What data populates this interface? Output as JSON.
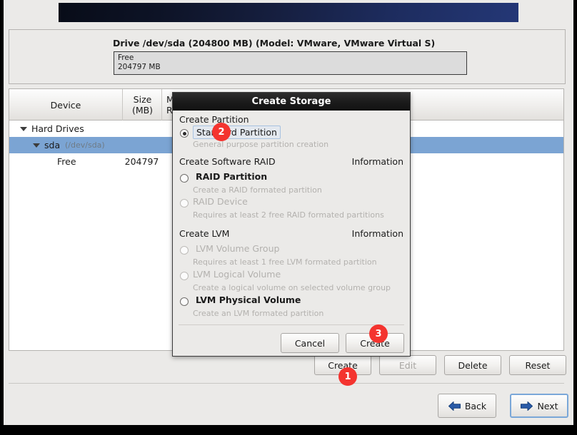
{
  "window": {
    "background_color": "#ebeae8",
    "banner_color_start": "#080c18",
    "banner_color_end": "#243776"
  },
  "drive_panel": {
    "title": "Drive /dev/sda (204800 MB) (Model: VMware, VMware Virtual S)",
    "segment_label": "Free",
    "segment_size": "204797 MB"
  },
  "table": {
    "headers": [
      {
        "label": "Device"
      },
      {
        "label": "Size\n(MB)",
        "line1": "Size",
        "line2": "(MB)"
      },
      {
        "label": "Mount Point/\nRAID/Volume",
        "line1": "Mo",
        "line2": "RA"
      },
      {
        "line1": "",
        "line2": ""
      }
    ],
    "rows": [
      {
        "name": "Hard Drives",
        "sub": "",
        "size": "",
        "indent": 0,
        "expander": true,
        "selected": false
      },
      {
        "name": "sda",
        "sub": "(/dev/sda)",
        "size": "",
        "indent": 1,
        "expander": true,
        "selected": true
      },
      {
        "name": "Free",
        "sub": "",
        "size": "204797",
        "indent": 2,
        "expander": false,
        "selected": false
      }
    ]
  },
  "action_buttons": [
    {
      "label": "Create",
      "enabled": true
    },
    {
      "label": "Edit",
      "enabled": false
    },
    {
      "label": "Delete",
      "enabled": true
    },
    {
      "label": "Reset",
      "enabled": true
    }
  ],
  "nav_buttons": {
    "back": {
      "label": "Back",
      "icon": "arrow-left-icon"
    },
    "next": {
      "label": "Next",
      "icon": "arrow-right-icon"
    }
  },
  "dialog": {
    "title": "Create Storage",
    "groups": [
      {
        "heading": "Create Partition",
        "information": "",
        "options": [
          {
            "label": "Standard Partition",
            "description": "General purpose partition creation",
            "selected": true,
            "enabled": true,
            "focused": true
          }
        ]
      },
      {
        "heading": "Create Software RAID",
        "information": "Information",
        "options": [
          {
            "label": "RAID Partition",
            "description": "Create a RAID formated partition",
            "selected": false,
            "enabled": true,
            "focused": false
          },
          {
            "label": "RAID Device",
            "description": "Requires at least 2 free RAID formated partitions",
            "selected": false,
            "enabled": false,
            "focused": false
          }
        ]
      },
      {
        "heading": "Create LVM",
        "information": "Information",
        "options": [
          {
            "label": "LVM Volume Group",
            "description": "Requires at least 1 free LVM formated partition",
            "selected": false,
            "enabled": false,
            "focused": false
          },
          {
            "label": "LVM Logical Volume",
            "description": "Create a logical volume on selected volume group",
            "selected": false,
            "enabled": false,
            "focused": false
          },
          {
            "label": "LVM Physical Volume",
            "description": "Create an LVM formated partition",
            "selected": false,
            "enabled": true,
            "focused": false
          }
        ]
      }
    ],
    "cancel_label": "Cancel",
    "create_label": "Create"
  },
  "markers": [
    {
      "number": "1"
    },
    {
      "number": "2"
    },
    {
      "number": "3"
    }
  ],
  "colors": {
    "marker_red": "#f4342f",
    "selection_blue": "#7ba4d3",
    "muted_text": "#b3b1ae",
    "focus_blue": "#7aa7d8"
  }
}
